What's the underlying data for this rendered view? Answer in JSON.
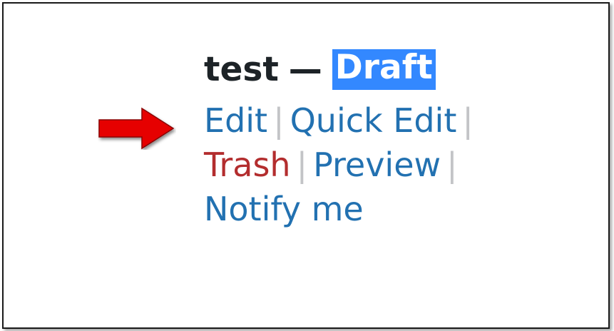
{
  "post": {
    "title": "test",
    "dash": "—",
    "status": "Draft"
  },
  "row_actions": {
    "edit": "Edit",
    "quick_edit": "Quick Edit",
    "trash": "Trash",
    "preview": "Preview",
    "notify": "Notify me",
    "separator": "|"
  },
  "colors": {
    "link": "#2271b1",
    "trash": "#b32d2e",
    "badge": "#3388ff",
    "arrow": "#e60000"
  },
  "annotation": {
    "icon": "red-arrow-icon"
  }
}
